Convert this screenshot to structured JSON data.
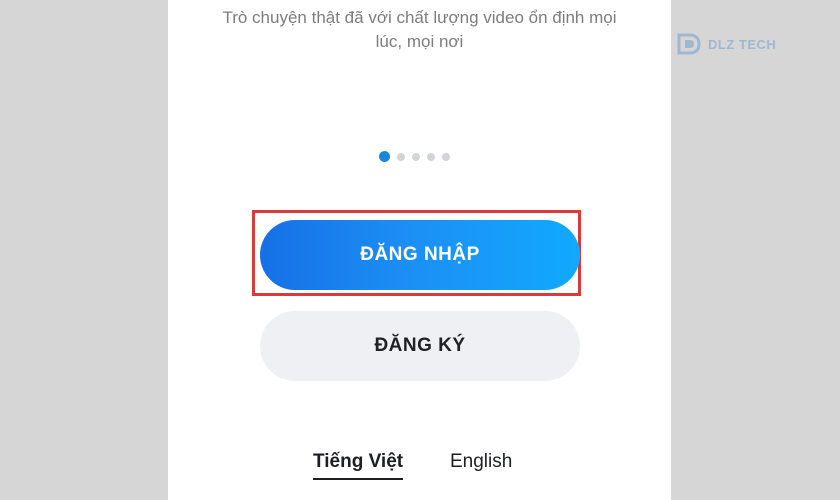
{
  "onboarding": {
    "tagline_line1": "Trò chuyện thật đã với chất lượng video ổn định mọi",
    "tagline_line2": "lúc, mọi nơi",
    "carousel": {
      "total": 5,
      "active_index": 0
    }
  },
  "actions": {
    "login_label": "ĐĂNG NHẬP",
    "register_label": "ĐĂNG KÝ"
  },
  "language": {
    "options": [
      "Tiếng Việt",
      "English"
    ],
    "selected": "Tiếng Việt"
  },
  "watermark": {
    "text": "DLZ TECH"
  },
  "colors": {
    "primary_gradient_start": "#1670e6",
    "primary_gradient_end": "#11a9ff",
    "active_dot": "#1b86dc",
    "highlight_border": "#d93b3b",
    "secondary_button_bg": "#eef0f4"
  }
}
